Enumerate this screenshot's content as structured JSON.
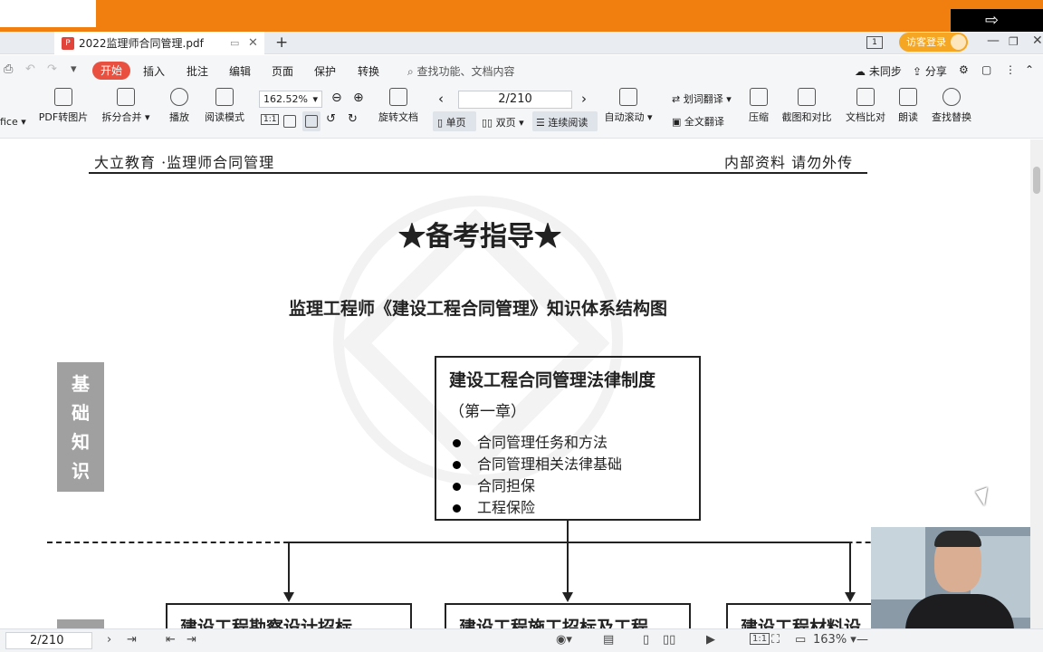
{
  "tab": {
    "title": "2022监理师合同管理.pdf",
    "badge": "P"
  },
  "titlebar_right": {
    "page_indicator": "1",
    "guest_login": "访客登录"
  },
  "menu": {
    "active": "开始",
    "items": [
      "插入",
      "批注",
      "编辑",
      "页面",
      "保护",
      "转换"
    ],
    "search_placeholder": "查找功能、文档内容",
    "right": {
      "sync": "未同步",
      "share": "分享"
    }
  },
  "ribbon": {
    "office_label": "fice",
    "pdf_to_image": "PDF转图片",
    "split_merge": "拆分合并",
    "play": "播放",
    "read_mode": "阅读模式",
    "zoom": "162.52%",
    "rotate_doc": "旋转文档",
    "page_input": "2/210",
    "single_page": "单页",
    "double_page": "双页",
    "continuous": "连续阅读",
    "auto_scroll": "自动滚动",
    "word_translate": "划词翻译",
    "full_translate": "全文翻译",
    "compress": "压缩",
    "screenshot_compare": "截图和对比",
    "doc_compare": "文档比对",
    "read_aloud": "朗读",
    "find_replace": "查找替换",
    "ratio_btn": "1:1"
  },
  "document": {
    "header_left": "大立教育 ·监理师合同管理",
    "header_right": "内部资料  请勿外传",
    "title": "★备考指导★",
    "subtitle": "监理工程师《建设工程合同管理》知识体系结构图",
    "side_label": [
      "基",
      "础",
      "知",
      "识"
    ],
    "main_box": {
      "title": "建设工程合同管理法律制度",
      "chapter": "（第一章）",
      "items": [
        "合同管理任务和方法",
        "合同管理相关法律基础",
        "合同担保",
        "工程保险"
      ]
    },
    "sub_boxes": [
      "建设工程勘察设计招标",
      "建设工程施工招标及工程",
      "建设工程材料设"
    ]
  },
  "statusbar": {
    "page": "2/210",
    "zoom": "163%",
    "ratio": "1:1"
  }
}
